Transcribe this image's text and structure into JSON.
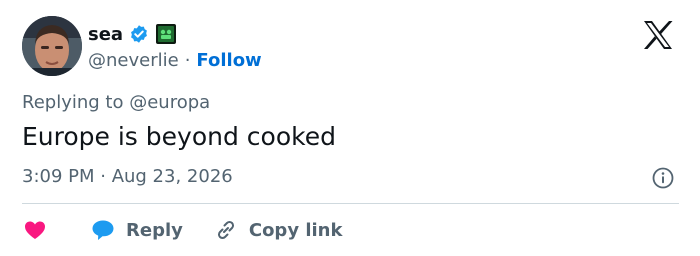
{
  "author": {
    "display_name": "sea",
    "handle": "@neverlie",
    "follow_label": "Follow",
    "separator": "·",
    "verified_color": "#1d9bf0"
  },
  "tweet": {
    "replying_prefix": "Replying to",
    "replying_to": "@europa",
    "text": "Europe is beyond cooked",
    "timestamp": "3:09 PM · Aug 23, 2026"
  },
  "actions": {
    "like_icon": "heart-icon",
    "reply_label": "Reply",
    "copy_link_label": "Copy link"
  },
  "colors": {
    "text": "#0f1419",
    "muted": "#536471",
    "link": "#006fd6",
    "like": "#f91880",
    "reply": "#1d9bf0"
  }
}
